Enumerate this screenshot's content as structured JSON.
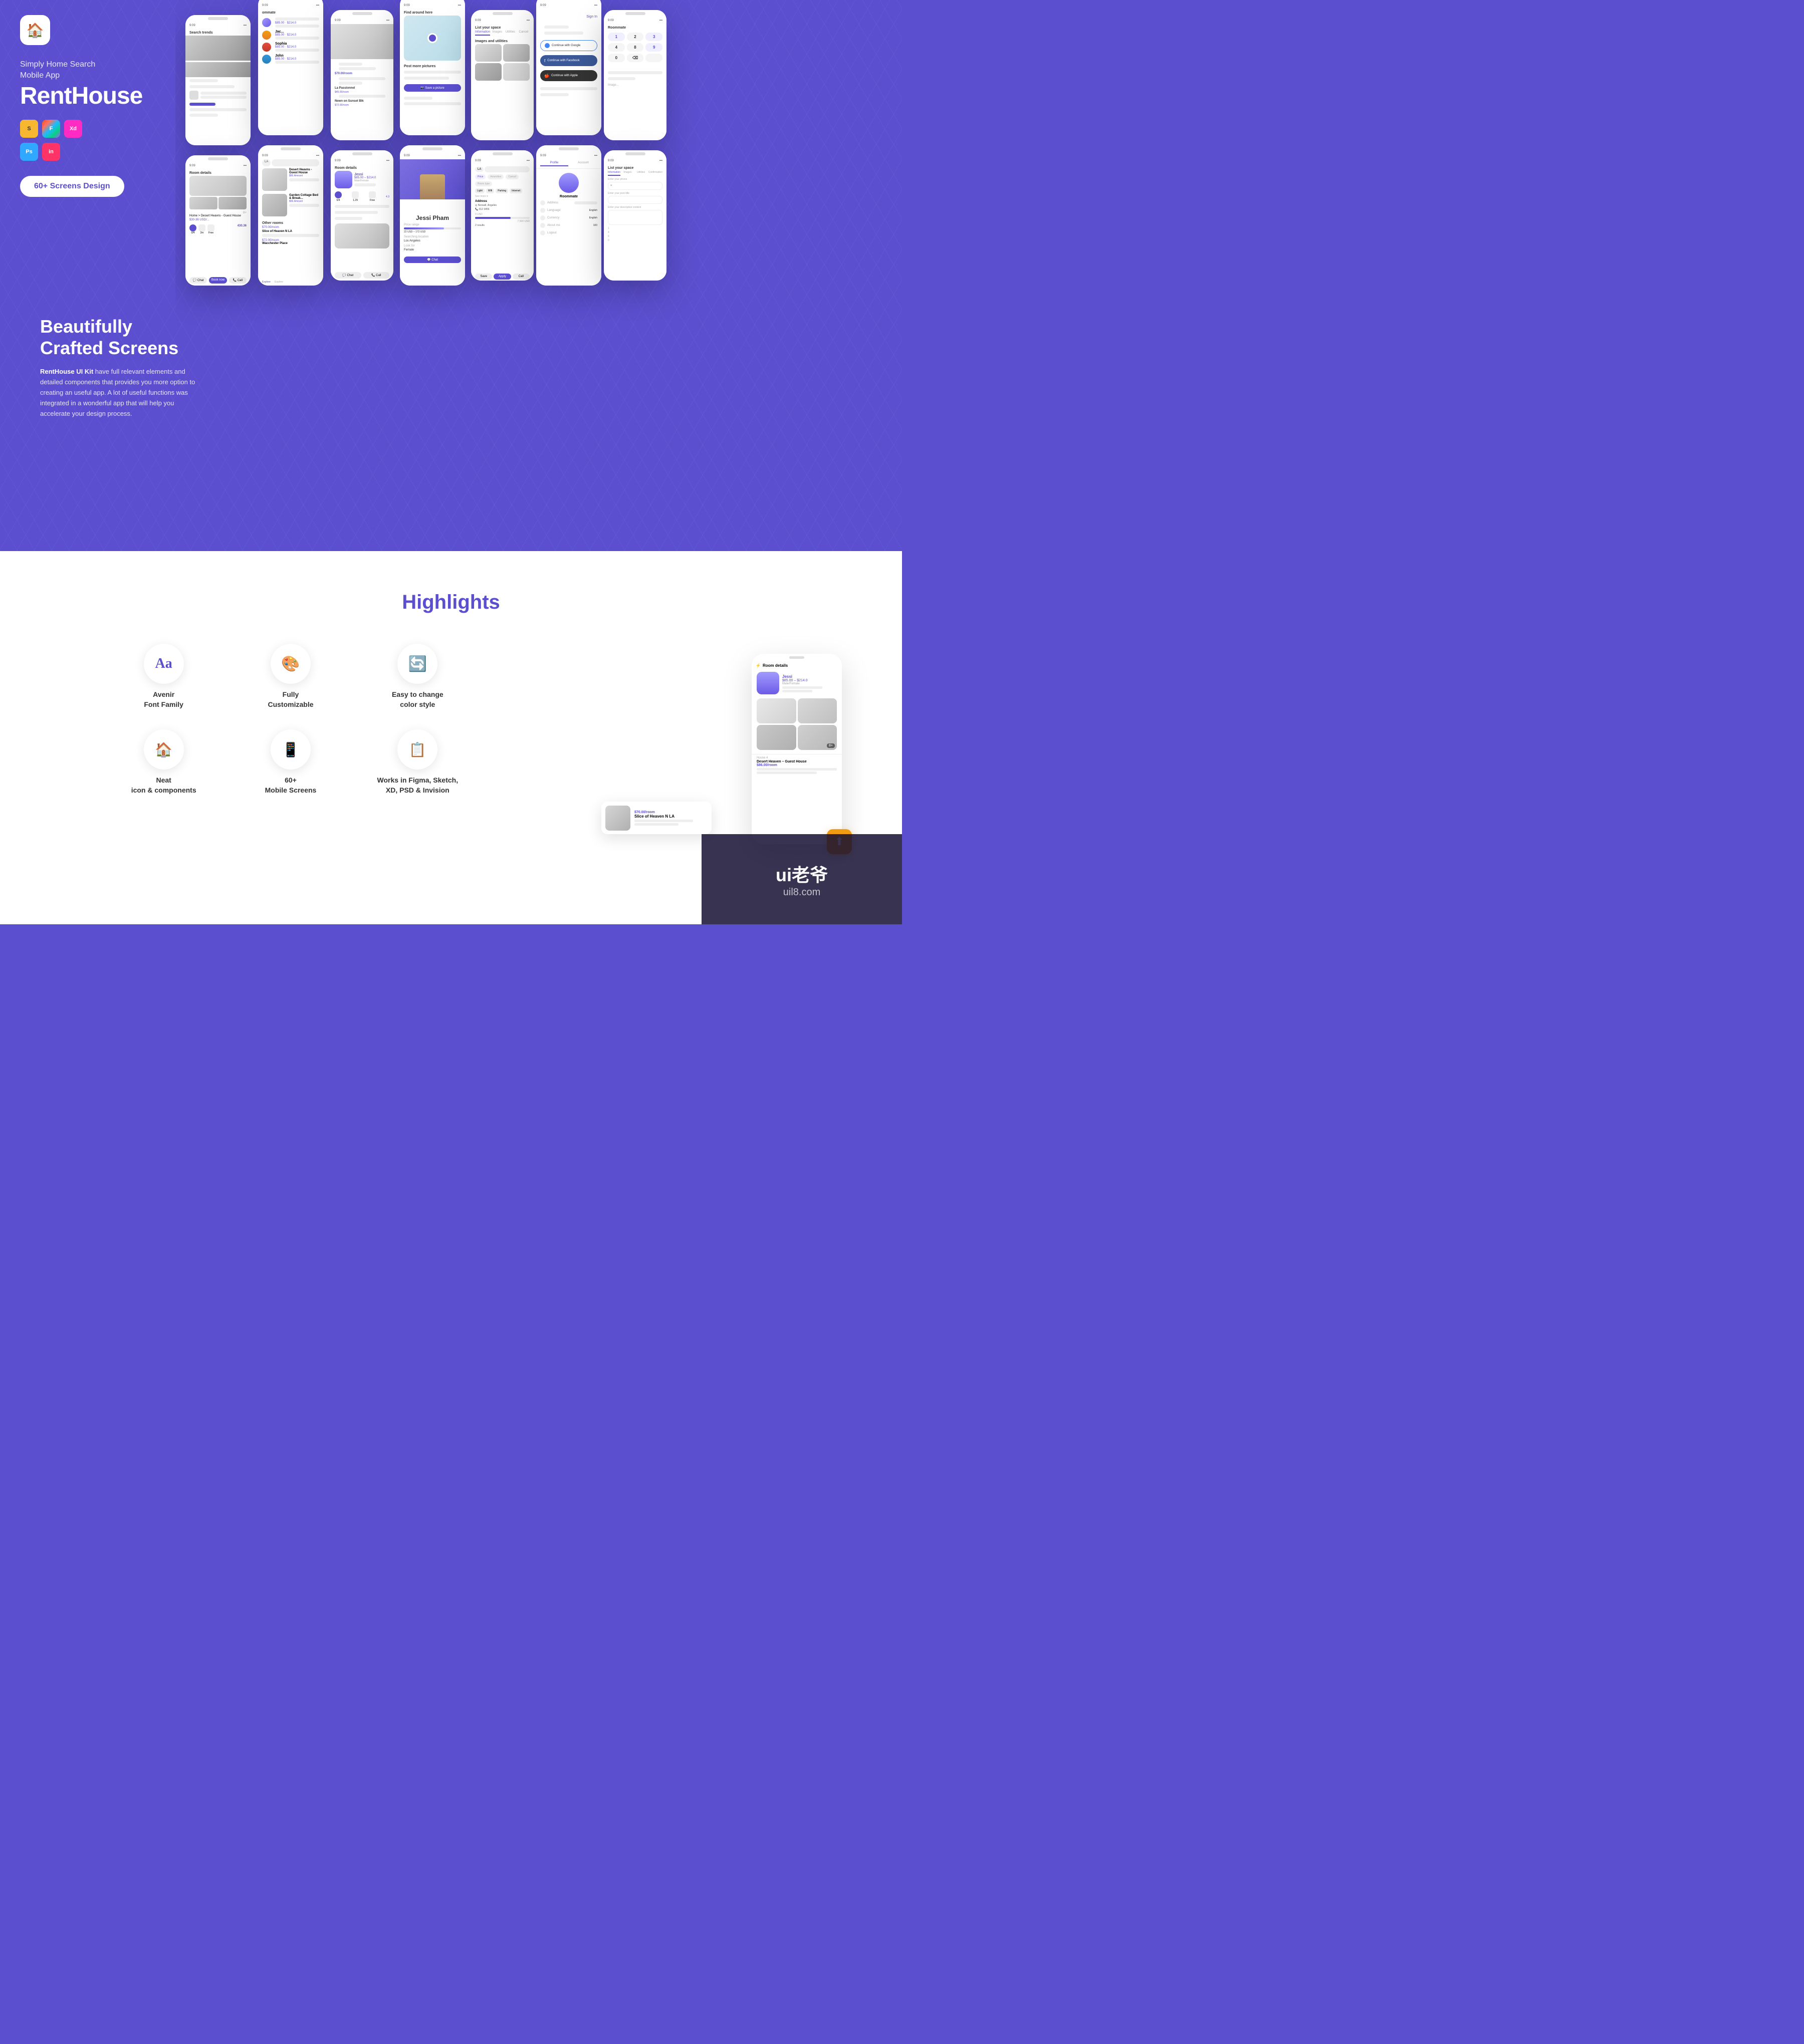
{
  "app": {
    "tagline": "Simply Home Search",
    "tagline2": "Mobile App",
    "title": "RentHouse",
    "screens_btn": "60+  Screens Design",
    "crafted_heading1": "Beautifully",
    "crafted_heading2": "Crafted Screens",
    "crafted_desc_strong": "RentHouse UI Kit",
    "crafted_desc": " have full relevant elements and detailed components that provides you more option to creating an useful app. A lot of useful functions was integrated in a wonderful app that will help you accelerate your design process."
  },
  "badges": [
    {
      "label": "S",
      "class": "badge-sketch",
      "title": "Sketch"
    },
    {
      "label": "F",
      "class": "badge-figma",
      "title": "Figma"
    },
    {
      "label": "Xd",
      "class": "badge-xd",
      "title": "Adobe XD"
    },
    {
      "label": "Ps",
      "class": "badge-ps",
      "title": "Photoshop"
    },
    {
      "label": "in",
      "class": "badge-in",
      "title": "InVision"
    }
  ],
  "highlights": {
    "title": "Highlights",
    "items": [
      {
        "icon": "Aa",
        "label1": "Avenir",
        "label2": "Font Family",
        "icon_type": "aa"
      },
      {
        "icon": "🎨",
        "label1": "Fully",
        "label2": "Customizable",
        "icon_type": "layers"
      },
      {
        "icon": "🔄",
        "label1": "Easy to change",
        "label2": "color style",
        "icon_type": "palette"
      },
      {
        "icon": "🏠",
        "label1": "Neat",
        "label2": "icon & components",
        "icon_type": "neat"
      },
      {
        "icon": "📱",
        "label1": "60+",
        "label2": "Mobile Screens",
        "icon_type": "screens"
      },
      {
        "icon": "📋",
        "label1": "Works in Figma, Sketch,",
        "label2": "XD, PSD & Invision",
        "icon_type": "works"
      }
    ]
  },
  "watermark": {
    "line1": "ui老爷",
    "line2": "uil8.com"
  }
}
